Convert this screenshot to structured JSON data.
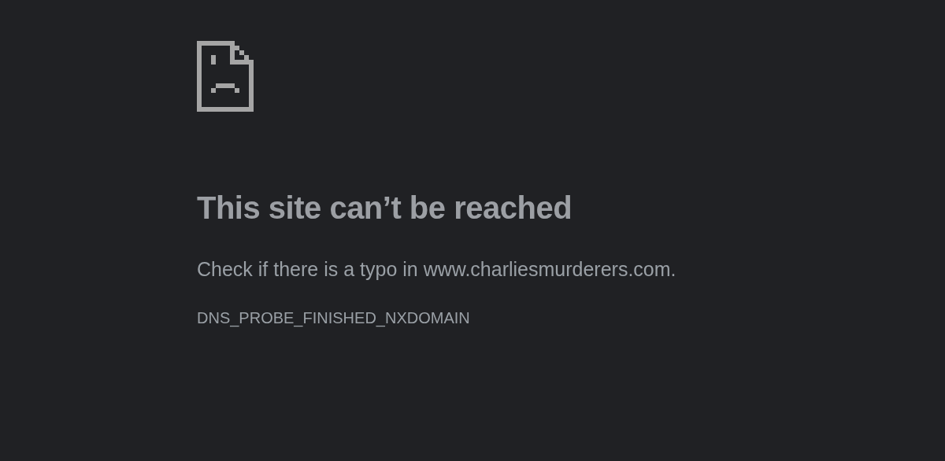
{
  "error": {
    "title": "This site can’t be reached",
    "message": "Check if there is a typo in www.charliesmurderers.com.",
    "code": "DNS_PROBE_FINISHED_NXDOMAIN"
  }
}
